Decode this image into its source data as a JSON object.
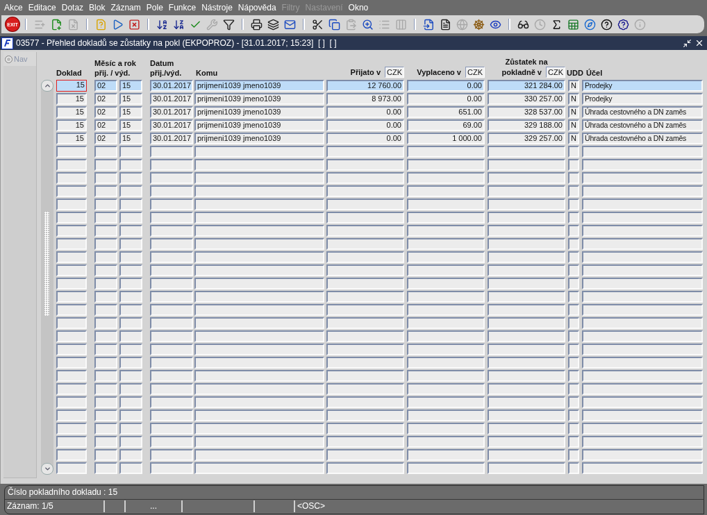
{
  "menu": [
    {
      "label": "Akce",
      "disabled": false
    },
    {
      "label": "Editace",
      "disabled": false
    },
    {
      "label": "Dotaz",
      "disabled": false
    },
    {
      "label": "Blok",
      "disabled": false
    },
    {
      "label": "Záznam",
      "disabled": false
    },
    {
      "label": "Pole",
      "disabled": false
    },
    {
      "label": "Funkce",
      "disabled": false
    },
    {
      "label": "Nástroje",
      "disabled": false
    },
    {
      "label": "Nápověda",
      "disabled": false
    },
    {
      "label": "Filtry",
      "disabled": true
    },
    {
      "label": "Nastavení",
      "disabled": true
    },
    {
      "label": "Okno",
      "disabled": false
    }
  ],
  "toolbar": [
    {
      "kind": "exit",
      "label": "EXIT",
      "disabled": false
    },
    {
      "kind": "separator"
    },
    {
      "kind": "add",
      "disabled": true
    },
    {
      "kind": "insert",
      "disabled": false
    },
    {
      "kind": "delete",
      "disabled": true
    },
    {
      "kind": "separator"
    },
    {
      "kind": "query",
      "disabled": false
    },
    {
      "kind": "execute",
      "disabled": false
    },
    {
      "kind": "cancel",
      "disabled": false
    },
    {
      "kind": "separator"
    },
    {
      "kind": "sort-asc",
      "disabled": false
    },
    {
      "kind": "sort-desc",
      "disabled": false
    },
    {
      "kind": "check",
      "disabled": false
    },
    {
      "kind": "wrench",
      "disabled": true
    },
    {
      "kind": "filter",
      "disabled": false
    },
    {
      "kind": "separator"
    },
    {
      "kind": "print",
      "disabled": false
    },
    {
      "kind": "print-all",
      "disabled": false
    },
    {
      "kind": "mail",
      "disabled": false
    },
    {
      "kind": "separator"
    },
    {
      "kind": "cut",
      "disabled": false
    },
    {
      "kind": "copy",
      "disabled": false
    },
    {
      "kind": "paste",
      "disabled": true
    },
    {
      "kind": "zoom",
      "disabled": false
    },
    {
      "kind": "list",
      "disabled": true
    },
    {
      "kind": "tree",
      "disabled": true
    },
    {
      "kind": "separator"
    },
    {
      "kind": "import",
      "disabled": false
    },
    {
      "kind": "document",
      "disabled": false
    },
    {
      "kind": "globe",
      "disabled": true
    },
    {
      "kind": "wheel",
      "disabled": false
    },
    {
      "kind": "eye",
      "disabled": false
    },
    {
      "kind": "separator"
    },
    {
      "kind": "glasses",
      "disabled": false
    },
    {
      "kind": "clock",
      "disabled": true
    },
    {
      "kind": "sigma",
      "disabled": false
    },
    {
      "kind": "excel",
      "disabled": false
    },
    {
      "kind": "browser",
      "disabled": false
    },
    {
      "kind": "help",
      "disabled": false
    },
    {
      "kind": "help-window",
      "disabled": false
    },
    {
      "kind": "info",
      "disabled": true
    }
  ],
  "window": {
    "title": "03577 - Přehled dokladů se zůstatky na pokl (EKPOPROZ) - [31.01.2017; 15:23]  [ ]  [ ]"
  },
  "nav": {
    "label": "Nav",
    "checked": false
  },
  "table": {
    "columns": [
      {
        "lines": [
          "Doklad"
        ]
      },
      {
        "lines": [
          "Měsíc a rok",
          "přij. / výd."
        ]
      },
      {
        "lines": [
          "Datum",
          "přij./výd."
        ]
      },
      {
        "lines": [
          "Komu"
        ]
      },
      {
        "lines": [
          "Přijato v"
        ],
        "currency": "CZK"
      },
      {
        "lines": [
          "Vyplaceno v"
        ],
        "currency": "CZK"
      },
      {
        "lines": [
          "Zůstatek na",
          "pokladně v"
        ],
        "currency": "CZK"
      },
      {
        "lines": [
          "UDD"
        ]
      },
      {
        "lines": [
          "Účel"
        ]
      }
    ],
    "rows": [
      {
        "selected": true,
        "focused": true,
        "cells": [
          "15",
          "02",
          "15",
          "30.01.2017",
          "prijmeni1039 jmeno1039",
          "12 760.00",
          "0.00",
          "321 284.00",
          "N",
          "Prodejky"
        ]
      },
      {
        "selected": false,
        "focused": false,
        "cells": [
          "15",
          "02",
          "15",
          "30.01.2017",
          "prijmeni1039 jmeno1039",
          "8 973.00",
          "0.00",
          "330 257.00",
          "N",
          "Prodejky"
        ]
      },
      {
        "selected": false,
        "focused": false,
        "cells": [
          "15",
          "02",
          "15",
          "30.01.2017",
          "prijmeni1039 jmeno1039",
          "0.00",
          "651.00",
          "328 537.00",
          "N",
          "Úhrada cestovného a DN zaměs"
        ]
      },
      {
        "selected": false,
        "focused": false,
        "cells": [
          "15",
          "02",
          "15",
          "30.01.2017",
          "prijmeni1039 jmeno1039",
          "0.00",
          "69.00",
          "329 188.00",
          "N",
          "Úhrada cestovného a DN zaměs"
        ]
      },
      {
        "selected": false,
        "focused": false,
        "cells": [
          "15",
          "02",
          "15",
          "30.01.2017",
          "prijmeni1039 jmeno1039",
          "0.00",
          "1 000.00",
          "329 257.00",
          "N",
          "Úhrada cestovného a DN zaměs"
        ]
      },
      {
        "selected": false,
        "focused": false
      },
      {
        "selected": false,
        "focused": false
      },
      {
        "selected": false,
        "focused": false
      },
      {
        "selected": false,
        "focused": false
      },
      {
        "selected": false,
        "focused": false
      },
      {
        "selected": false,
        "focused": false
      },
      {
        "selected": false,
        "focused": false
      },
      {
        "selected": false,
        "focused": false
      },
      {
        "selected": false,
        "focused": false
      },
      {
        "selected": false,
        "focused": false
      },
      {
        "selected": false,
        "focused": false
      },
      {
        "selected": false,
        "focused": false
      },
      {
        "selected": false,
        "focused": false
      },
      {
        "selected": false,
        "focused": false
      },
      {
        "selected": false,
        "focused": false
      },
      {
        "selected": false,
        "focused": false
      },
      {
        "selected": false,
        "focused": false
      },
      {
        "selected": false,
        "focused": false
      },
      {
        "selected": false,
        "focused": false
      },
      {
        "selected": false,
        "focused": false
      },
      {
        "selected": false,
        "focused": false
      },
      {
        "selected": false,
        "focused": false
      },
      {
        "selected": false,
        "focused": false
      },
      {
        "selected": false,
        "focused": false
      },
      {
        "selected": false,
        "focused": false
      }
    ]
  },
  "status_bar": {
    "message": "Číslo pokladního dokladu : 15",
    "fields": [
      "Záznam: 1/5",
      "...",
      "<OSC>"
    ]
  }
}
